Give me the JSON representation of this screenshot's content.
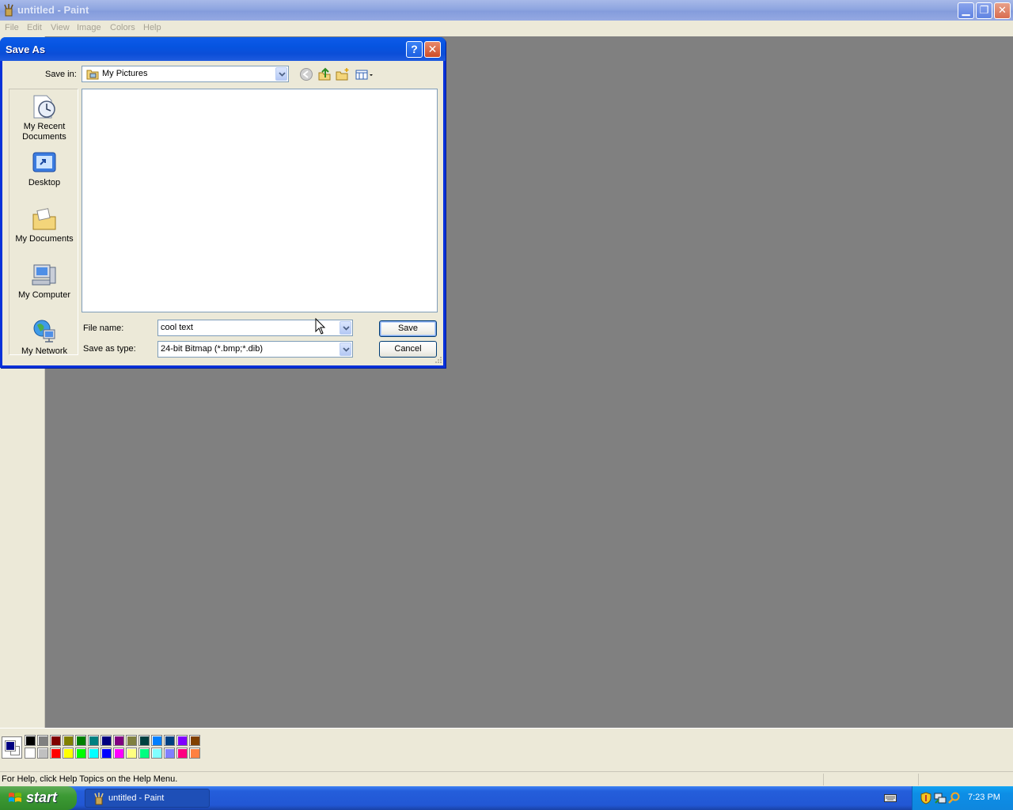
{
  "app": {
    "title": "untitled - Paint",
    "menu": [
      "File",
      "Edit",
      "View",
      "Image",
      "Colors",
      "Help"
    ],
    "window_controls": [
      "minimize-icon",
      "restore-icon",
      "close-icon"
    ]
  },
  "dialog": {
    "title": "Save As",
    "help_button": "?",
    "save_in_label": "Save in:",
    "save_in_value": "My Pictures",
    "toolbar_icons": [
      "back-icon",
      "up-folder-icon",
      "new-folder-icon",
      "view-menu-icon"
    ],
    "places": [
      {
        "label": "My Recent Documents",
        "icon": "recent-documents-icon"
      },
      {
        "label": "Desktop",
        "icon": "desktop-icon"
      },
      {
        "label": "My Documents",
        "icon": "my-documents-icon"
      },
      {
        "label": "My Computer",
        "icon": "my-computer-icon"
      },
      {
        "label": "My Network",
        "icon": "network-icon"
      }
    ],
    "file_name_label": "File name:",
    "file_name_value": "cool text",
    "save_as_type_label": "Save as type:",
    "save_as_type_value": "24-bit Bitmap (*.bmp;*.dib)",
    "save_button": "Save",
    "cancel_button": "Cancel"
  },
  "palette": {
    "foreground": "#000080",
    "background": "#ffffff",
    "row1": [
      "#000000",
      "#808080",
      "#800000",
      "#808000",
      "#008000",
      "#008080",
      "#000080",
      "#800080",
      "#808040",
      "#004040",
      "#0080ff",
      "#004080",
      "#8000ff",
      "#804000"
    ],
    "row2": [
      "#ffffff",
      "#c0c0c0",
      "#ff0000",
      "#ffff00",
      "#00ff00",
      "#00ffff",
      "#0000ff",
      "#ff00ff",
      "#ffff80",
      "#00ff80",
      "#80ffff",
      "#8080ff",
      "#ff0080",
      "#ff8040"
    ]
  },
  "status": {
    "text": "For Help, click Help Topics on the Help Menu."
  },
  "taskbar": {
    "start_label": "start",
    "task_label": "untitled - Paint",
    "clock": "7:23 PM",
    "tray_icons": [
      "security-shield-icon",
      "network-tray-icon",
      "search-tray-icon"
    ]
  }
}
